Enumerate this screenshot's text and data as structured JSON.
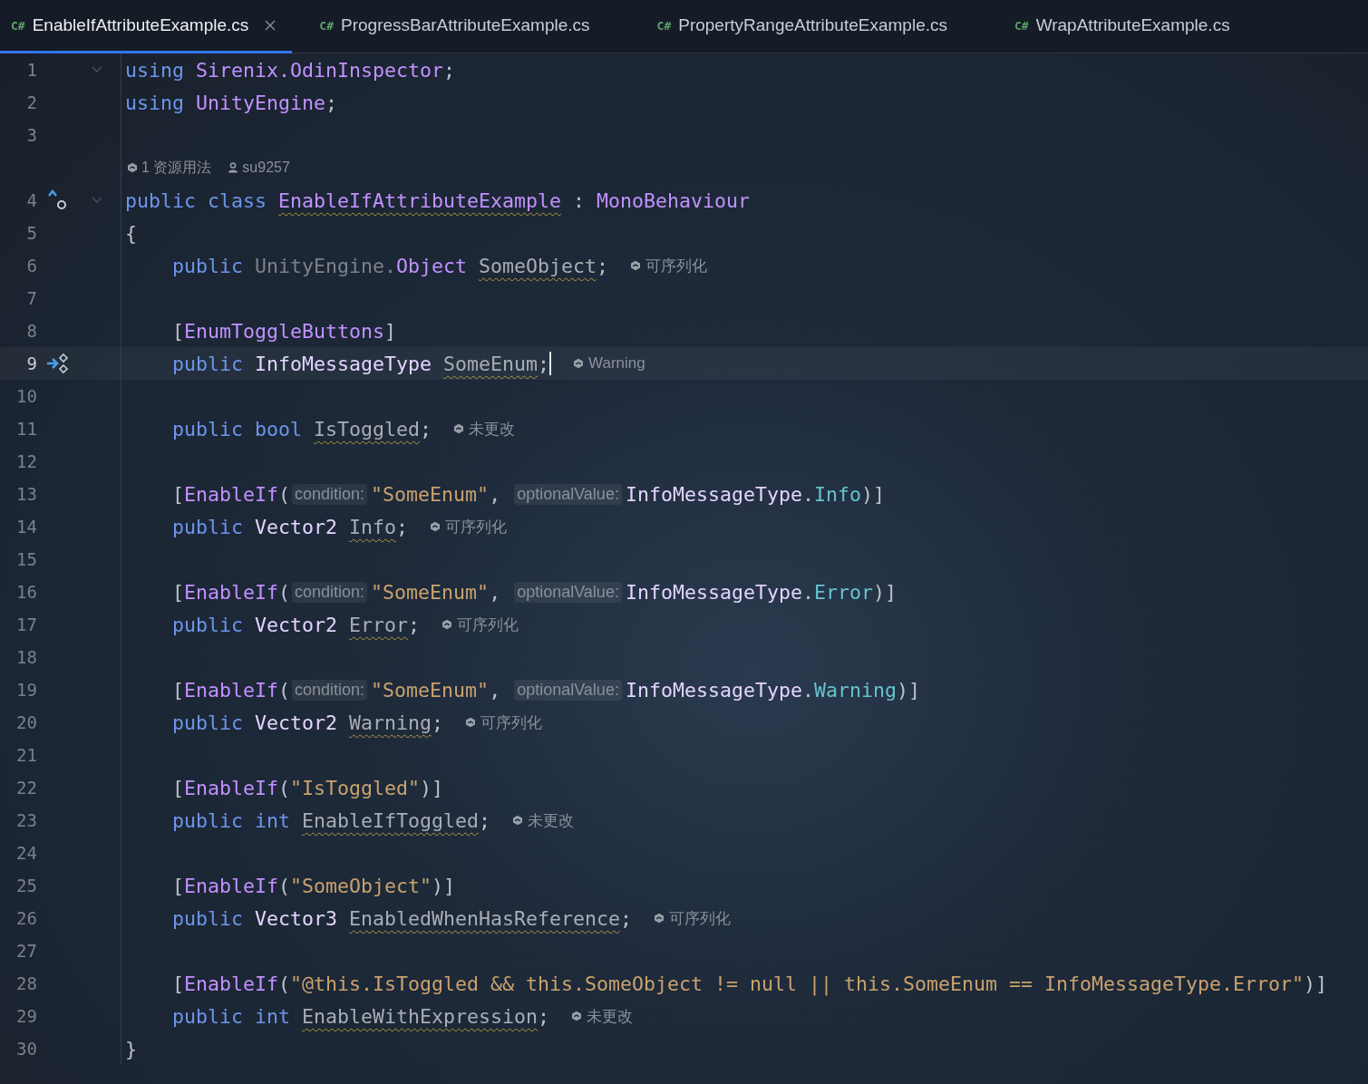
{
  "tabs": [
    {
      "lang": "C#",
      "label": "EnableIfAttributeExample.cs",
      "selected": true
    },
    {
      "lang": "C#",
      "label": "ProgressBarAttributeExample.cs",
      "selected": false
    },
    {
      "lang": "C#",
      "label": "PropertyRangeAttributeExample.cs",
      "selected": false
    },
    {
      "lang": "C#",
      "label": "WrapAttributeExample.cs",
      "selected": false
    }
  ],
  "lines": [
    {
      "kind": "code",
      "number": "1",
      "current": false,
      "fold": true,
      "indent": false,
      "parts": [
        {
          "kind": "code",
          "tokens": [
            {
              "kind": "keyword",
              "text": "using "
            },
            {
              "kind": "symbol",
              "text": "Sirenix.OdinInspector"
            },
            {
              "kind": "plain",
              "text": ";"
            }
          ]
        }
      ]
    },
    {
      "kind": "code",
      "number": "2",
      "current": false,
      "fold": false,
      "indent": false,
      "parts": [
        {
          "kind": "code",
          "tokens": [
            {
              "kind": "keyword",
              "text": "using "
            },
            {
              "kind": "symbol",
              "text": "UnityEngine"
            },
            {
              "kind": "plain",
              "text": ";"
            }
          ]
        }
      ]
    },
    {
      "kind": "code",
      "number": "3",
      "current": false,
      "fold": false
    },
    {
      "kind": "lens",
      "items": [
        {
          "kind": "usages",
          "text": "1 资源用法"
        },
        {
          "kind": "author",
          "text": "su9257"
        }
      ]
    },
    {
      "kind": "code",
      "number": "4",
      "current": false,
      "fold": true,
      "gutter": {
        "kind": "implemented"
      },
      "indent": false,
      "parts": [
        {
          "kind": "code",
          "tokens": [
            {
              "kind": "keyword",
              "text": "public class "
            },
            {
              "kind": "declared",
              "text": "EnableIfAttributeExample"
            },
            {
              "kind": "plain",
              "text": " : "
            },
            {
              "kind": "symbol",
              "text": "MonoBehaviour"
            }
          ]
        }
      ]
    },
    {
      "kind": "code",
      "number": "5",
      "current": false,
      "fold": false,
      "indent": false,
      "parts": [
        {
          "kind": "code",
          "tokens": [
            {
              "kind": "plain",
              "text": "{"
            }
          ]
        }
      ]
    },
    {
      "kind": "code",
      "number": "6",
      "current": false,
      "fold": false,
      "indent": true,
      "parts": [
        {
          "kind": "code",
          "tokens": [
            {
              "kind": "keyword",
              "text": "public "
            },
            {
              "kind": "dimmed",
              "text": "UnityEngine."
            },
            {
              "kind": "symbol",
              "text": "Object "
            },
            {
              "kind": "field",
              "text": "SomeObject"
            },
            {
              "kind": "plain",
              "text": ";"
            }
          ]
        }
      ],
      "hint": "可序列化"
    },
    {
      "kind": "code",
      "number": "7",
      "current": false,
      "fold": false
    },
    {
      "kind": "code",
      "number": "8",
      "current": false,
      "fold": false,
      "indent": true,
      "parts": [
        {
          "kind": "code",
          "tokens": [
            {
              "kind": "plain",
              "text": "["
            },
            {
              "kind": "symbol",
              "text": "EnumToggleButtons"
            },
            {
              "kind": "plain",
              "text": "]"
            }
          ]
        }
      ]
    },
    {
      "kind": "code",
      "number": "9",
      "current": true,
      "fold": false,
      "gutter": {
        "kind": "run"
      },
      "indent": true,
      "parts": [
        {
          "kind": "code",
          "tokens": [
            {
              "kind": "keyword",
              "text": "public "
            },
            {
              "kind": "type",
              "text": "InfoMessageType "
            },
            {
              "kind": "field",
              "text": "SomeEnum"
            },
            {
              "kind": "plain",
              "text": ";"
            }
          ]
        }
      ],
      "hint": "Warning"
    },
    {
      "kind": "code",
      "number": "10",
      "current": false,
      "fold": false
    },
    {
      "kind": "code",
      "number": "11",
      "current": false,
      "fold": false,
      "indent": true,
      "parts": [
        {
          "kind": "code",
          "tokens": [
            {
              "kind": "keyword",
              "text": "public bool "
            },
            {
              "kind": "field",
              "text": "IsToggled"
            },
            {
              "kind": "plain",
              "text": ";"
            }
          ]
        }
      ],
      "hint": "未更改"
    },
    {
      "kind": "code",
      "number": "12",
      "current": false,
      "fold": false
    },
    {
      "kind": "code",
      "number": "13",
      "current": false,
      "fold": false,
      "indent": true,
      "parts": [
        {
          "kind": "code",
          "tokens": [
            {
              "kind": "plain",
              "text": "["
            },
            {
              "kind": "symbol",
              "text": "EnableIf"
            },
            {
              "kind": "plain",
              "text": "("
            }
          ]
        },
        {
          "kind": "param-hint",
          "text": "condition:"
        },
        {
          "kind": "code",
          "tokens": [
            {
              "kind": "string",
              "text": "\"SomeEnum\""
            },
            {
              "kind": "plain",
              "text": ", "
            }
          ]
        },
        {
          "kind": "param-hint",
          "text": "optionalValue:"
        },
        {
          "kind": "code",
          "tokens": [
            {
              "kind": "type",
              "text": "InfoMessageType"
            },
            {
              "kind": "plain",
              "text": "."
            },
            {
              "kind": "member",
              "text": "Info"
            },
            {
              "kind": "plain",
              "text": ")]"
            }
          ]
        }
      ]
    },
    {
      "kind": "code",
      "number": "14",
      "current": false,
      "fold": false,
      "indent": true,
      "parts": [
        {
          "kind": "code",
          "tokens": [
            {
              "kind": "keyword",
              "text": "public "
            },
            {
              "kind": "type",
              "text": "Vector2 "
            },
            {
              "kind": "field",
              "text": "Info"
            },
            {
              "kind": "plain",
              "text": ";"
            }
          ]
        }
      ],
      "hint": "可序列化"
    },
    {
      "kind": "code",
      "number": "15",
      "current": false,
      "fold": false
    },
    {
      "kind": "code",
      "number": "16",
      "current": false,
      "fold": false,
      "indent": true,
      "parts": [
        {
          "kind": "code",
          "tokens": [
            {
              "kind": "plain",
              "text": "["
            },
            {
              "kind": "symbol",
              "text": "EnableIf"
            },
            {
              "kind": "plain",
              "text": "("
            }
          ]
        },
        {
          "kind": "param-hint",
          "text": "condition:"
        },
        {
          "kind": "code",
          "tokens": [
            {
              "kind": "string",
              "text": "\"SomeEnum\""
            },
            {
              "kind": "plain",
              "text": ", "
            }
          ]
        },
        {
          "kind": "param-hint",
          "text": "optionalValue:"
        },
        {
          "kind": "code",
          "tokens": [
            {
              "kind": "type",
              "text": "InfoMessageType"
            },
            {
              "kind": "plain",
              "text": "."
            },
            {
              "kind": "member",
              "text": "Error"
            },
            {
              "kind": "plain",
              "text": ")]"
            }
          ]
        }
      ]
    },
    {
      "kind": "code",
      "number": "17",
      "current": false,
      "fold": false,
      "indent": true,
      "parts": [
        {
          "kind": "code",
          "tokens": [
            {
              "kind": "keyword",
              "text": "public "
            },
            {
              "kind": "type",
              "text": "Vector2 "
            },
            {
              "kind": "field",
              "text": "Error"
            },
            {
              "kind": "plain",
              "text": ";"
            }
          ]
        }
      ],
      "hint": "可序列化"
    },
    {
      "kind": "code",
      "number": "18",
      "current": false,
      "fold": false
    },
    {
      "kind": "code",
      "number": "19",
      "current": false,
      "fold": false,
      "indent": true,
      "parts": [
        {
          "kind": "code",
          "tokens": [
            {
              "kind": "plain",
              "text": "["
            },
            {
              "kind": "symbol",
              "text": "EnableIf"
            },
            {
              "kind": "plain",
              "text": "("
            }
          ]
        },
        {
          "kind": "param-hint",
          "text": "condition:"
        },
        {
          "kind": "code",
          "tokens": [
            {
              "kind": "string",
              "text": "\"SomeEnum\""
            },
            {
              "kind": "plain",
              "text": ", "
            }
          ]
        },
        {
          "kind": "param-hint",
          "text": "optionalValue:"
        },
        {
          "kind": "code",
          "tokens": [
            {
              "kind": "type",
              "text": "InfoMessageType"
            },
            {
              "kind": "plain",
              "text": "."
            },
            {
              "kind": "member",
              "text": "Warning"
            },
            {
              "kind": "plain",
              "text": ")]"
            }
          ]
        }
      ]
    },
    {
      "kind": "code",
      "number": "20",
      "current": false,
      "fold": false,
      "indent": true,
      "parts": [
        {
          "kind": "code",
          "tokens": [
            {
              "kind": "keyword",
              "text": "public "
            },
            {
              "kind": "type",
              "text": "Vector2 "
            },
            {
              "kind": "field",
              "text": "Warning"
            },
            {
              "kind": "plain",
              "text": ";"
            }
          ]
        }
      ],
      "hint": "可序列化"
    },
    {
      "kind": "code",
      "number": "21",
      "current": false,
      "fold": false
    },
    {
      "kind": "code",
      "number": "22",
      "current": false,
      "fold": false,
      "indent": true,
      "parts": [
        {
          "kind": "code",
          "tokens": [
            {
              "kind": "plain",
              "text": "["
            },
            {
              "kind": "symbol",
              "text": "EnableIf"
            },
            {
              "kind": "plain",
              "text": "("
            },
            {
              "kind": "string",
              "text": "\"IsToggled\""
            },
            {
              "kind": "plain",
              "text": ")]"
            }
          ]
        }
      ]
    },
    {
      "kind": "code",
      "number": "23",
      "current": false,
      "fold": false,
      "indent": true,
      "parts": [
        {
          "kind": "code",
          "tokens": [
            {
              "kind": "keyword",
              "text": "public int "
            },
            {
              "kind": "field",
              "text": "EnableIfToggled"
            },
            {
              "kind": "plain",
              "text": ";"
            }
          ]
        }
      ],
      "hint": "未更改"
    },
    {
      "kind": "code",
      "number": "24",
      "current": false,
      "fold": false
    },
    {
      "kind": "code",
      "number": "25",
      "current": false,
      "fold": false,
      "indent": true,
      "parts": [
        {
          "kind": "code",
          "tokens": [
            {
              "kind": "plain",
              "text": "["
            },
            {
              "kind": "symbol",
              "text": "EnableIf"
            },
            {
              "kind": "plain",
              "text": "("
            },
            {
              "kind": "string",
              "text": "\"SomeObject\""
            },
            {
              "kind": "plain",
              "text": ")]"
            }
          ]
        }
      ]
    },
    {
      "kind": "code",
      "number": "26",
      "current": false,
      "fold": false,
      "indent": true,
      "parts": [
        {
          "kind": "code",
          "tokens": [
            {
              "kind": "keyword",
              "text": "public "
            },
            {
              "kind": "type",
              "text": "Vector3 "
            },
            {
              "kind": "field",
              "text": "EnabledWhenHasReference"
            },
            {
              "kind": "plain",
              "text": ";"
            }
          ]
        }
      ],
      "hint": "可序列化"
    },
    {
      "kind": "code",
      "number": "27",
      "current": false,
      "fold": false
    },
    {
      "kind": "code",
      "number": "28",
      "current": false,
      "fold": false,
      "indent": true,
      "parts": [
        {
          "kind": "code",
          "tokens": [
            {
              "kind": "plain",
              "text": "["
            },
            {
              "kind": "symbol",
              "text": "EnableIf"
            },
            {
              "kind": "plain",
              "text": "("
            },
            {
              "kind": "string",
              "text": "\"@this.IsToggled && this.SomeObject != null || this.SomeEnum == InfoMessageType.Error\""
            },
            {
              "kind": "plain",
              "text": ")]"
            }
          ]
        }
      ]
    },
    {
      "kind": "code",
      "number": "29",
      "current": false,
      "fold": false,
      "indent": true,
      "parts": [
        {
          "kind": "code",
          "tokens": [
            {
              "kind": "keyword",
              "text": "public int "
            },
            {
              "kind": "field",
              "text": "EnableWithExpression"
            },
            {
              "kind": "plain",
              "text": ";"
            }
          ]
        }
      ],
      "hint": "未更改"
    },
    {
      "kind": "code",
      "number": "30",
      "current": false,
      "fold": false,
      "indent": false,
      "parts": [
        {
          "kind": "code",
          "tokens": [
            {
              "kind": "plain",
              "text": "}"
            }
          ]
        }
      ]
    }
  ]
}
